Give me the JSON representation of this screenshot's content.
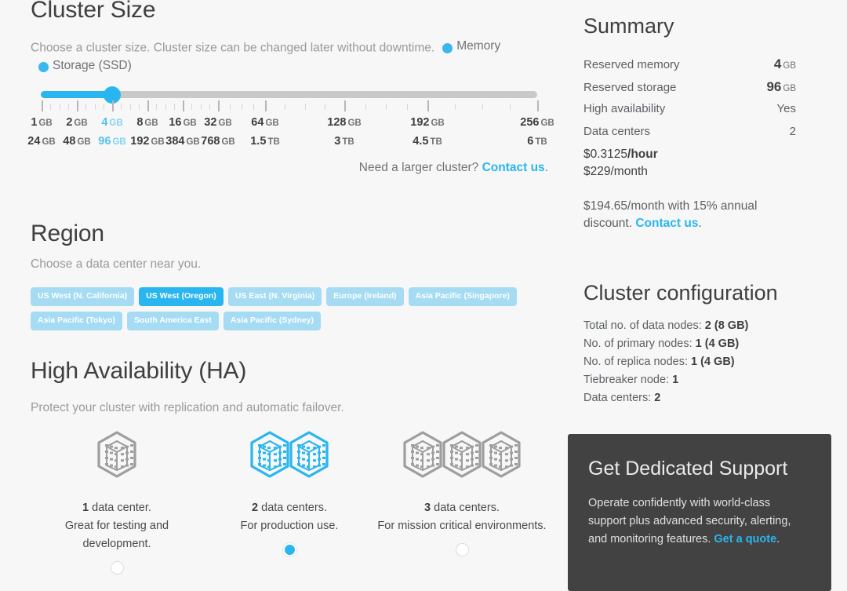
{
  "cluster_size": {
    "title": "Cluster Size",
    "description": "Choose a cluster size. Cluster size can be changed later without downtime.",
    "legend": [
      {
        "label": "Memory",
        "color": "#3ab7ec"
      },
      {
        "label": "Storage (SSD)",
        "color": "#3ab7ec"
      }
    ],
    "slider": {
      "selected_index": 2,
      "memory_labels": [
        "1 GB",
        "2 GB",
        "4 GB",
        "8 GB",
        "16 GB",
        "32 GB",
        "64 GB",
        "128 GB",
        "192 GB",
        "256 GB"
      ],
      "storage_labels": [
        "24 GB",
        "48 GB",
        "96 GB",
        "192 GB",
        "384 GB",
        "768 GB",
        "1.5 TB",
        "3 TB",
        "4.5 TB",
        "6 TB"
      ]
    },
    "footer_text": "Need a larger cluster? ",
    "footer_link": "Contact us",
    "footer_period": "."
  },
  "region": {
    "title": "Region",
    "description": "Choose a data center near you.",
    "options": [
      {
        "label": "US West (N. California)",
        "selected": false
      },
      {
        "label": "US West (Oregon)",
        "selected": true
      },
      {
        "label": "US East (N. Virginia)",
        "selected": false
      },
      {
        "label": "Europe (Ireland)",
        "selected": false
      },
      {
        "label": "Asia Pacific (Singapore)",
        "selected": false
      },
      {
        "label": "Asia Pacific (Tokyo)",
        "selected": false
      },
      {
        "label": "South America East",
        "selected": false
      },
      {
        "label": "Asia Pacific (Sydney)",
        "selected": false
      }
    ]
  },
  "high_availability": {
    "title": "High Availability (HA)",
    "description": "Protect your cluster with replication and automatic failover.",
    "options": [
      {
        "count": 1,
        "count_label": "1",
        "title_rest": " data center.",
        "desc": "Great for testing and development.",
        "selected": false
      },
      {
        "count": 2,
        "count_label": "2",
        "title_rest": " data centers.",
        "desc": "For production use.",
        "selected": true
      },
      {
        "count": 3,
        "count_label": "3",
        "title_rest": " data centers.",
        "desc": "For mission critical environments.",
        "selected": false
      }
    ]
  },
  "summary": {
    "title": "Summary",
    "rows": [
      {
        "label": "Reserved memory",
        "value": "4",
        "unit": "GB",
        "strong": true
      },
      {
        "label": "Reserved storage",
        "value": "96",
        "unit": "GB",
        "strong": true
      },
      {
        "label": "High availability",
        "value": "Yes",
        "unit": "",
        "strong": false
      },
      {
        "label": "Data centers",
        "value": "2",
        "unit": "",
        "strong": false
      }
    ],
    "price_amount": "$0.3125",
    "price_period": "/hour",
    "price_monthly": "$229/month",
    "discount_text": "$194.65/month with 15% annual discount. ",
    "discount_link": "Contact us",
    "discount_period": "."
  },
  "cluster_configuration": {
    "title": "Cluster configuration",
    "rows": [
      {
        "label": "Total no. of data nodes: ",
        "value": "2 (8 GB)"
      },
      {
        "label": "No. of primary nodes: ",
        "value": "1 (4 GB)"
      },
      {
        "label": "No. of replica nodes: ",
        "value": "1 (4 GB)"
      },
      {
        "label": "Tiebreaker node: ",
        "value": "1"
      },
      {
        "label": "Data centers: ",
        "value": "2"
      }
    ]
  },
  "support": {
    "title": "Get Dedicated Support",
    "body": "Operate confidently with world-class support plus advanced security, alerting, and monitoring features. ",
    "link": "Get a quote",
    "period": "."
  },
  "colors": {
    "accent": "#29b6f0",
    "accent_light": "#a5dcf3",
    "background": "#f7f7f7",
    "dark_panel": "#424242",
    "icon_gray": "#9e9e9e"
  }
}
